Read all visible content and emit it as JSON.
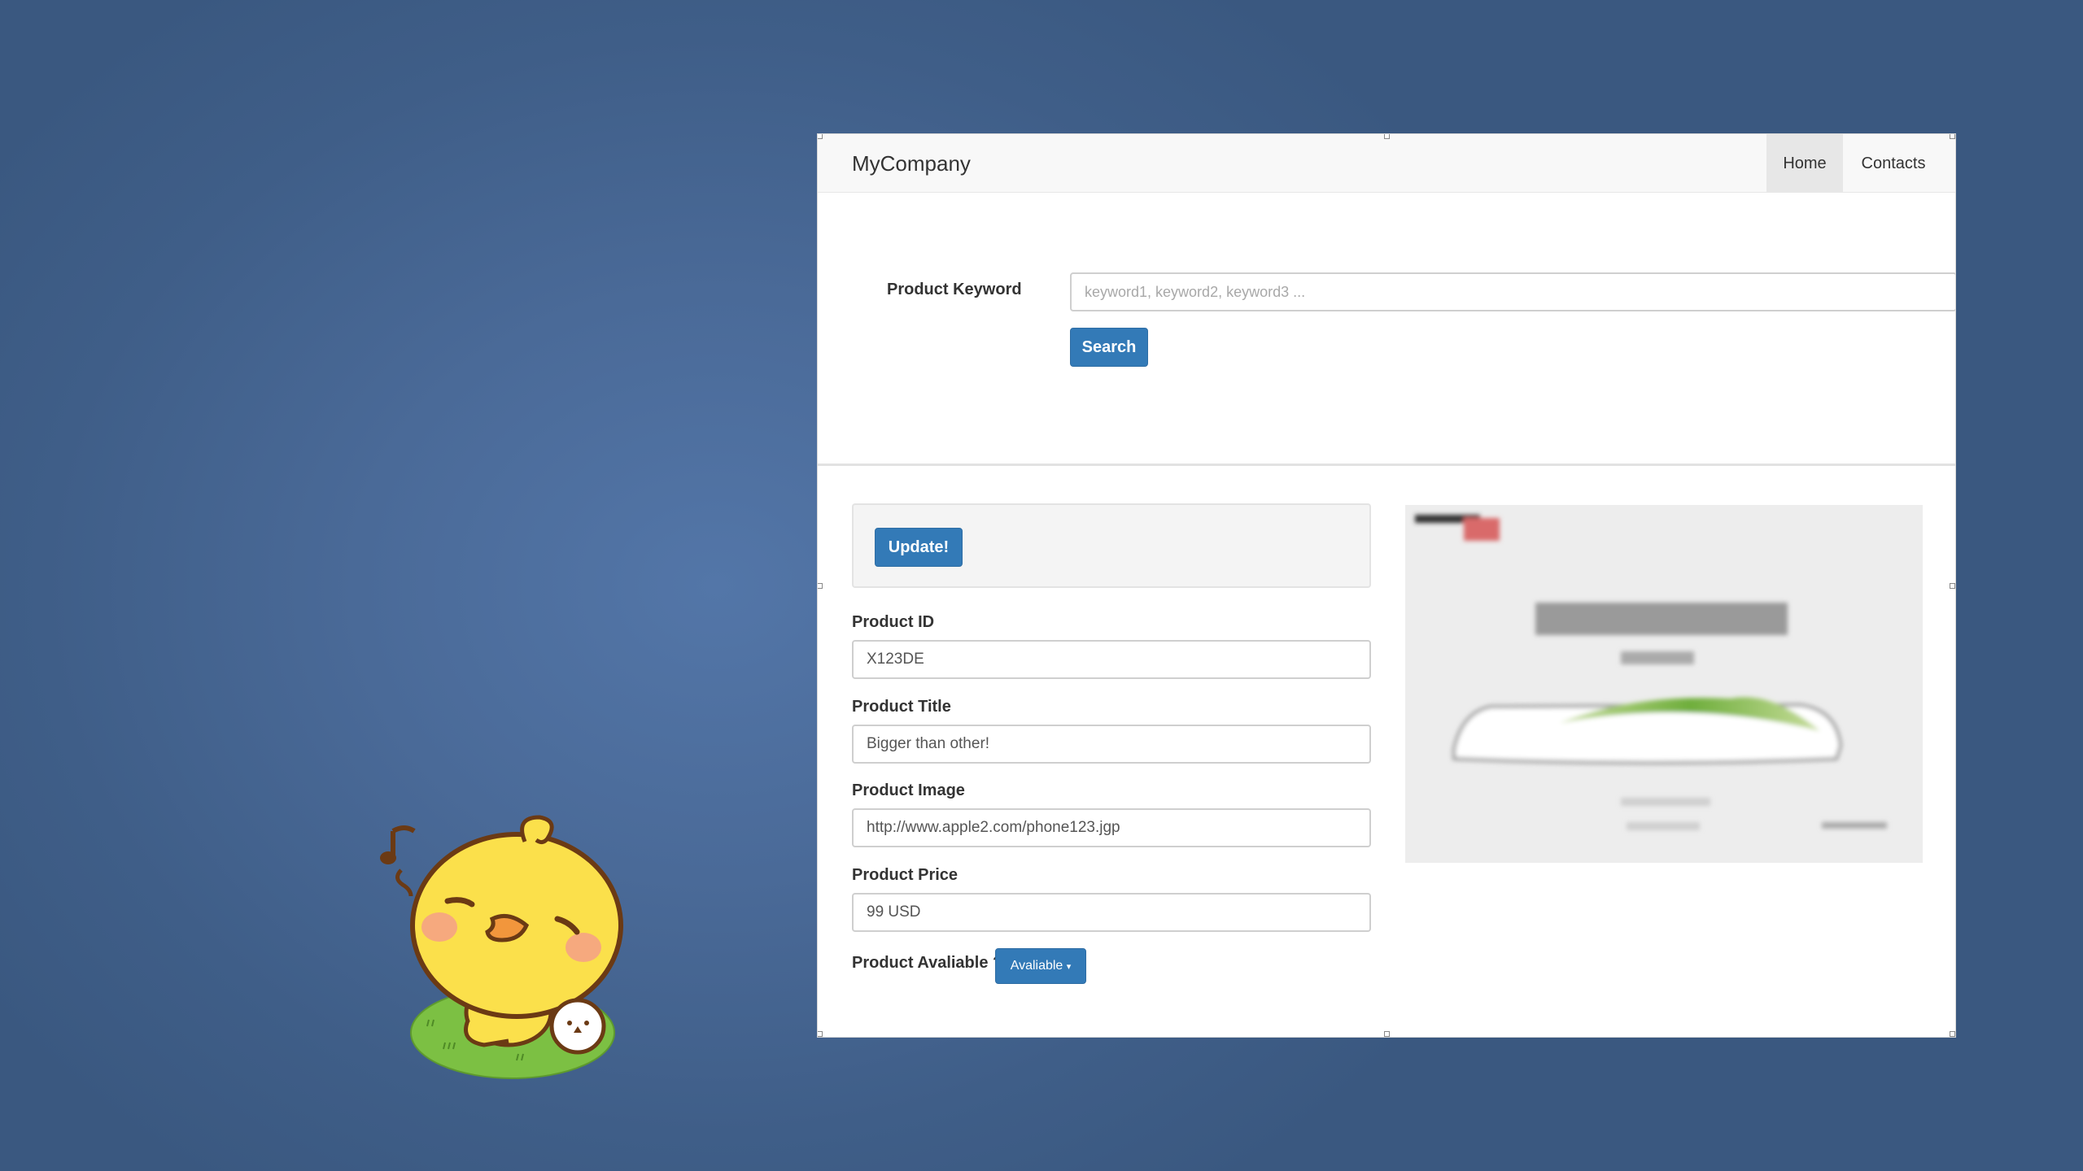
{
  "navbar": {
    "brand": "MyCompany",
    "items": [
      {
        "label": "Home",
        "active": true
      },
      {
        "label": "Contacts",
        "active": false
      }
    ]
  },
  "search": {
    "label": "Product Keyword",
    "placeholder": "keyword1, keyword2, keyword3 ...",
    "button": "Search"
  },
  "form": {
    "update_button": "Update!",
    "fields": {
      "product_id": {
        "label": "Product ID",
        "value": "X123DE"
      },
      "product_title": {
        "label": "Product Title",
        "value": "Bigger than other!"
      },
      "product_image": {
        "label": "Product Image",
        "value": "http://www.apple2.com/phone123.jgp"
      },
      "product_price": {
        "label": "Product Price",
        "value": "99 USD"
      }
    },
    "available": {
      "label": "Product Avaliable ?",
      "selected": "Avaliable"
    }
  },
  "colors": {
    "primary": "#337ab7",
    "background": "#4a6a98",
    "navbar_bg": "#f8f8f8"
  },
  "icons": {
    "dropdown": "caret-down-icon",
    "sticker": "yellow-chick-sticker",
    "music": "music-note-icon"
  }
}
